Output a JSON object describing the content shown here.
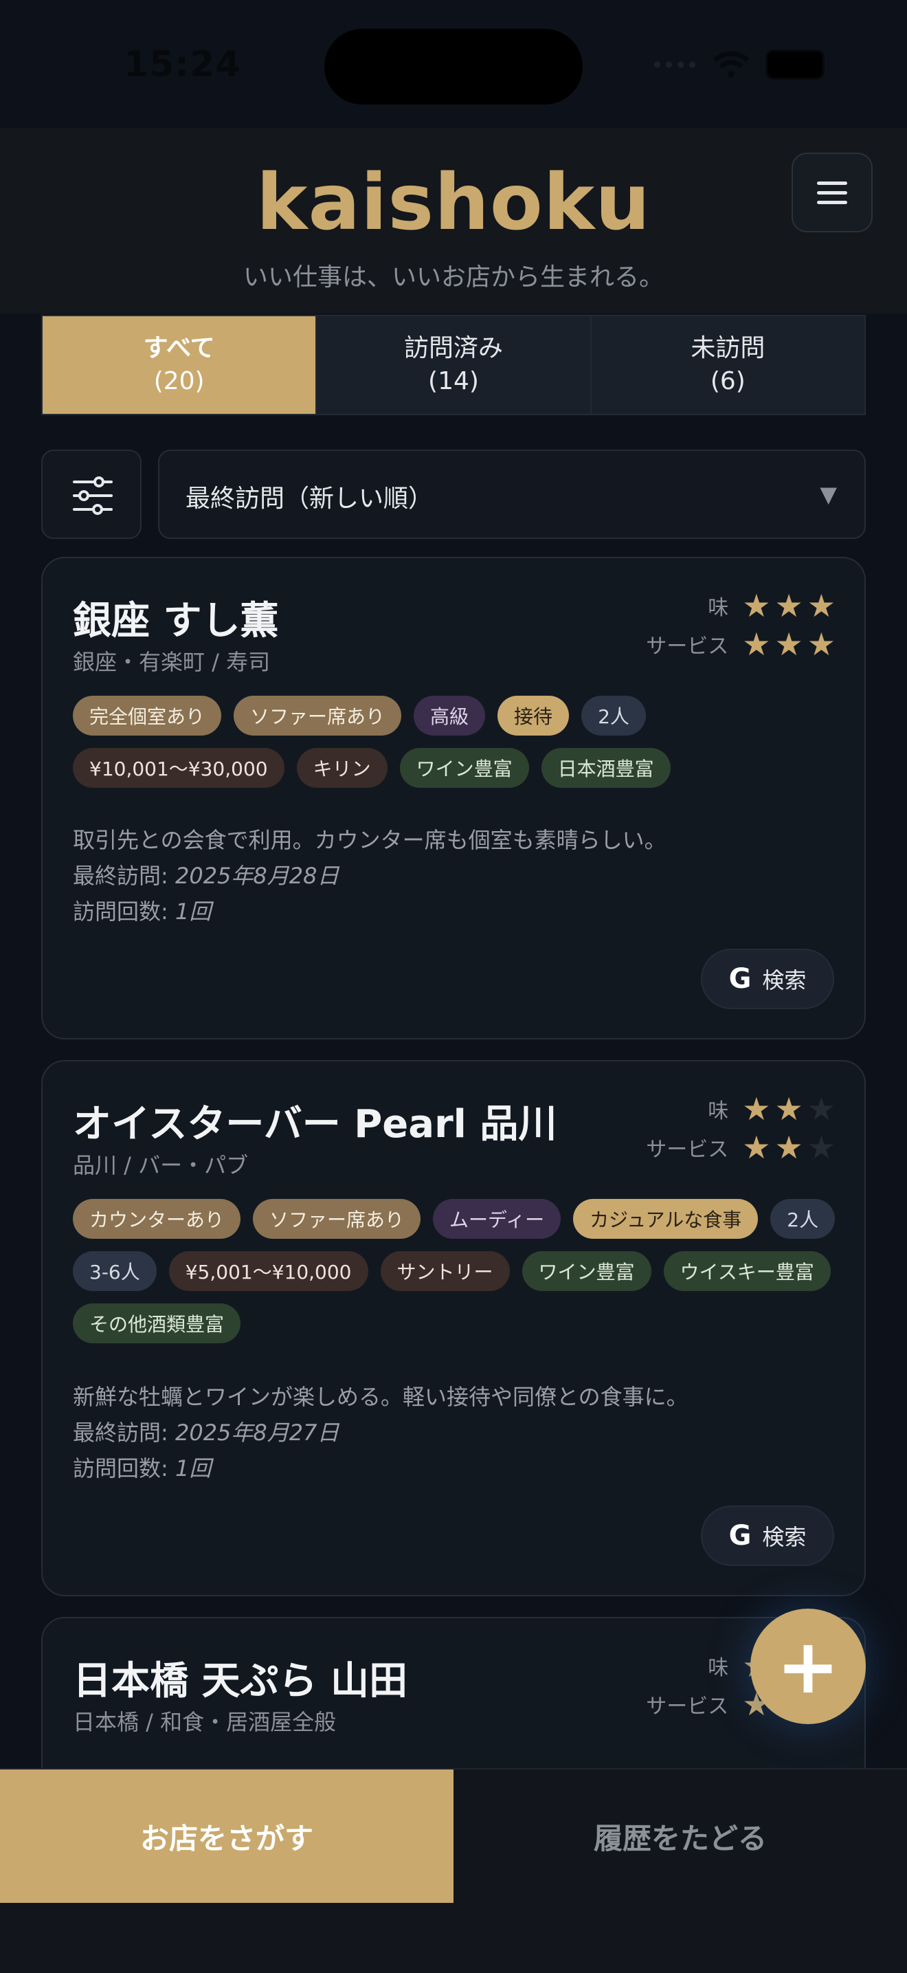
{
  "status": {
    "time": "15:24"
  },
  "header": {
    "brand": "kaishoku",
    "tagline": "いい仕事は、いいお店から生まれる。",
    "menu_icon": "hamburger-menu-icon"
  },
  "tabs": [
    {
      "label": "すべて",
      "count": "(20)",
      "active": true
    },
    {
      "label": "訪問済み",
      "count": "(14)",
      "active": false
    },
    {
      "label": "未訪問",
      "count": "(6)",
      "active": false
    }
  ],
  "toolbar": {
    "filter_icon": "sliders-icon",
    "sort_label": "最終訪問（新しい順）",
    "sort_arrow": "▼"
  },
  "ratings_labels": {
    "taste": "味",
    "service": "サービス"
  },
  "cards": [
    {
      "name": "銀座 すし薫",
      "location": "銀座・有楽町 / 寿司",
      "taste_stars": 3,
      "service_stars": 3,
      "tags": [
        {
          "text": "完全個室あり",
          "style": "tan"
        },
        {
          "text": "ソファー席あり",
          "style": "tan"
        },
        {
          "text": "高級",
          "style": "purple"
        },
        {
          "text": "接待",
          "style": "gold"
        },
        {
          "text": "2人",
          "style": "slate"
        },
        {
          "text": "¥10,001～¥30,000",
          "style": "brown"
        },
        {
          "text": "キリン",
          "style": "brown"
        },
        {
          "text": "ワイン豊富",
          "style": "green"
        },
        {
          "text": "日本酒豊富",
          "style": "green"
        }
      ],
      "comment": "取引先との会食で利用。カウンター席も個室も素晴らしい。",
      "last_visit_label": "最終訪問: ",
      "last_visit": "2025年8月28日",
      "visit_count_label": "訪問回数: ",
      "visit_count": "1回",
      "search_label": "検索"
    },
    {
      "name": "オイスターバー Pearl 品川",
      "location": "品川 / バー・パブ",
      "taste_stars": 2,
      "service_stars": 2,
      "tags": [
        {
          "text": "カウンターあり",
          "style": "tan"
        },
        {
          "text": "ソファー席あり",
          "style": "tan"
        },
        {
          "text": "ムーディー",
          "style": "purple"
        },
        {
          "text": "カジュアルな食事",
          "style": "gold"
        },
        {
          "text": "2人",
          "style": "slate"
        },
        {
          "text": "3-6人",
          "style": "slate"
        },
        {
          "text": "¥5,001～¥10,000",
          "style": "brown"
        },
        {
          "text": "サントリー",
          "style": "brown"
        },
        {
          "text": "ワイン豊富",
          "style": "green"
        },
        {
          "text": "ウイスキー豊富",
          "style": "green"
        },
        {
          "text": "その他酒類豊富",
          "style": "green"
        }
      ],
      "comment": "新鮮な牡蠣とワインが楽しめる。軽い接待や同僚との食事に。",
      "last_visit_label": "最終訪問: ",
      "last_visit": "2025年8月27日",
      "visit_count_label": "訪問回数: ",
      "visit_count": "1回",
      "search_label": "検索"
    },
    {
      "name": "日本橋 天ぷら 山田",
      "location": "日本橋 / 和食・居酒屋全般",
      "taste_stars": 3,
      "service_stars": 3
    }
  ],
  "fab": {
    "icon": "plus-icon",
    "label": "+"
  },
  "bottom_nav": {
    "search": "お店をさがす",
    "history": "履歴をたどる"
  },
  "colors": {
    "accent": "#c9a96e",
    "background": "#0d121a",
    "card": "#121820"
  }
}
